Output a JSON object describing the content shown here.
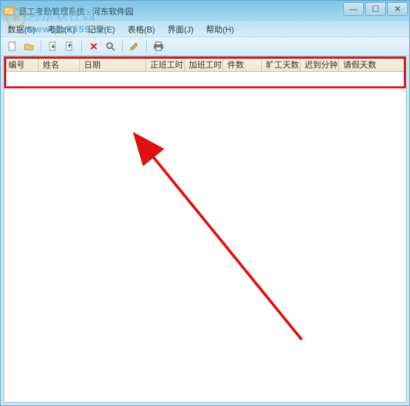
{
  "title": "员工考勤管理系统 - 河东软件园",
  "window_controls": {
    "min": "—",
    "max": "☐",
    "close": "✕"
  },
  "menubar": [
    {
      "label": "数据(S)"
    },
    {
      "label": "考勤(K)"
    },
    {
      "label": "记录(E)"
    },
    {
      "label": "表格(B)"
    },
    {
      "label": "界面(J)"
    },
    {
      "label": "帮助(H)"
    }
  ],
  "watermark": {
    "site_text": "河东软件园",
    "url_text": "www.pc0359.cn"
  },
  "columns": {
    "id": "编号",
    "name": "姓名",
    "date": "日期",
    "reg": "正班工时",
    "ot": "加班工时",
    "pcs": "件数",
    "abs": "旷工天数",
    "late": "迟到分钟",
    "leave": "请假天数"
  }
}
